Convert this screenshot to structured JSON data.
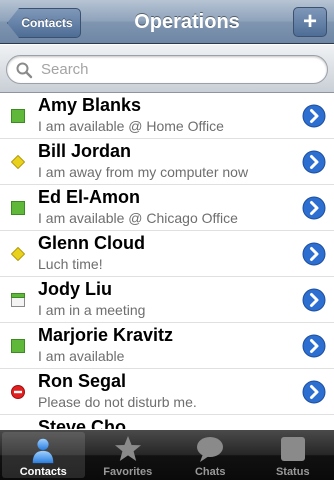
{
  "navbar": {
    "back_label": "Contacts",
    "title": "Operations",
    "add_label": "+"
  },
  "search": {
    "placeholder": "Search"
  },
  "contacts": [
    {
      "name": "Amy Blanks",
      "status_text": "I am available @ Home Office",
      "status": "available",
      "status_icon": "green-square-icon",
      "status_color": "#5fb83a"
    },
    {
      "name": "Bill Jordan",
      "status_text": "I am away from my computer now",
      "status": "away",
      "status_icon": "yellow-diamond-icon",
      "status_color": "#e8d21e"
    },
    {
      "name": "Ed El-Amon",
      "status_text": "I am available @ Chicago Office",
      "status": "available",
      "status_icon": "green-square-icon",
      "status_color": "#5fb83a"
    },
    {
      "name": "Glenn Cloud",
      "status_text": "Luch time!",
      "status": "away",
      "status_icon": "yellow-diamond-icon",
      "status_color": "#e8d21e"
    },
    {
      "name": "Jody Liu",
      "status_text": "I am in a meeting",
      "status": "meeting",
      "status_icon": "calendar-square-icon",
      "status_color": "#5fb83a"
    },
    {
      "name": "Marjorie Kravitz",
      "status_text": "I am available",
      "status": "available",
      "status_icon": "green-square-icon",
      "status_color": "#5fb83a"
    },
    {
      "name": "Ron Segal",
      "status_text": "Please do not disturb me.",
      "status": "dnd",
      "status_icon": "red-no-entry-icon",
      "status_color": "#e22020"
    },
    {
      "name": "Steve Cho",
      "status_text": "",
      "status": "available",
      "status_icon": "green-square-icon",
      "status_color": "#5fb83a"
    }
  ],
  "tabs": [
    {
      "label": "Contacts",
      "icon": "person-icon",
      "selected": true
    },
    {
      "label": "Favorites",
      "icon": "star-icon",
      "selected": false
    },
    {
      "label": "Chats",
      "icon": "speech-bubble-icon",
      "selected": false
    },
    {
      "label": "Status",
      "icon": "status-square-icon",
      "selected": false
    }
  ],
  "colors": {
    "accent_blue": "#2d6fd1",
    "nav_blue": "#6f87a5"
  }
}
